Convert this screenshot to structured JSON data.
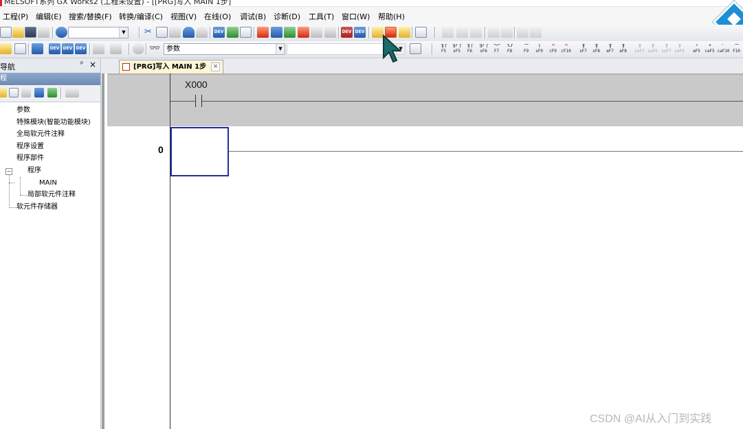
{
  "window": {
    "title": "MELSOFT系列 GX Works2 (工程未设置) - [[PRG]写入 MAIN 1步]"
  },
  "menu": [
    "工程(P)",
    "编辑(E)",
    "搜索/替换(F)",
    "转换/编译(C)",
    "视图(V)",
    "在线(O)",
    "调试(B)",
    "诊断(D)",
    "工具(T)",
    "窗口(W)",
    "帮助(H)"
  ],
  "toolbar": {
    "combo_value": "",
    "parameter_combo": "参数",
    "dev_label": "DEV"
  },
  "ladder_keys": [
    {
      "sym": "╢├",
      "key": "F5"
    },
    {
      "sym": "╢/├",
      "key": "sF5"
    },
    {
      "sym": "╢├",
      "key": "F6"
    },
    {
      "sym": "╢/├",
      "key": "sF6"
    },
    {
      "sym": "<>",
      "key": "F7"
    },
    {
      "sym": "{}",
      "key": "F8"
    },
    {
      "sym": "—",
      "key": "F9"
    },
    {
      "sym": "|",
      "key": "sF9"
    },
    {
      "sym": "✕",
      "key": "cF9"
    },
    {
      "sym": "✕",
      "key": "cF10"
    },
    {
      "sym": "╫",
      "key": "sF7"
    },
    {
      "sym": "╫",
      "key": "sF8"
    },
    {
      "sym": "╫",
      "key": "aF7"
    },
    {
      "sym": "╫",
      "key": "aF8"
    },
    {
      "sym": "╫",
      "key": "saF5"
    },
    {
      "sym": "╫",
      "key": "saF6"
    },
    {
      "sym": "╫",
      "key": "saF7"
    },
    {
      "sym": "╫",
      "key": "saF8"
    },
    {
      "sym": "↑",
      "key": "aF5"
    },
    {
      "sym": "↓",
      "key": "caF5"
    },
    {
      "sym": "⌐",
      "key": "caF10"
    },
    {
      "sym": "—",
      "key": "F10"
    }
  ],
  "navigation": {
    "title": "导航",
    "pin": "ᵖ",
    "close": "×",
    "subtitle": "程",
    "tree": [
      {
        "label": "参数"
      },
      {
        "label": "特殊模块(智能功能模块)"
      },
      {
        "label": "全局软元件注释"
      },
      {
        "label": "程序设置"
      },
      {
        "label": "程序部件"
      },
      {
        "label": "程序"
      },
      {
        "label": "MAIN"
      },
      {
        "label": "局部软元件注释"
      },
      {
        "label": "软元件存储器"
      }
    ]
  },
  "editor": {
    "tab_label": "[PRG]写入 MAIN 1步",
    "tab_close": "×",
    "contact_label": "X000",
    "step_number": "0"
  },
  "watermark": "CSDN @AI从入门到实践",
  "colors": {
    "cursor_box": "#1a2f9e",
    "nav_header": "#6d8ab5",
    "tab_bg": "#fdf5d6"
  }
}
